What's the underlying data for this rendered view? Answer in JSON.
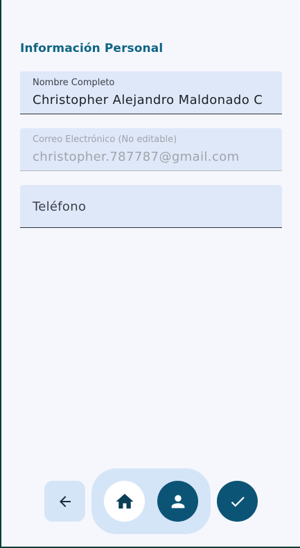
{
  "section": {
    "title": "Información Personal"
  },
  "form": {
    "full_name": {
      "label": "Nombre Completo",
      "value": "Christopher Alejandro Maldonado C"
    },
    "email": {
      "label": "Correo Electrónico (No editable)",
      "value": "christopher.787787@gmail.com"
    },
    "phone": {
      "placeholder": "Teléfono",
      "value": ""
    }
  },
  "nav": {
    "back_icon": "arrow-back-icon",
    "home_icon": "home-icon",
    "profile_icon": "person-icon",
    "save_icon": "check-icon"
  },
  "colors": {
    "accent": "#0c5476",
    "title": "#0f6583",
    "field_bg": "#dfe8f8",
    "nav_bg": "#d5e5f8",
    "page_bg": "#f6f7fd"
  }
}
